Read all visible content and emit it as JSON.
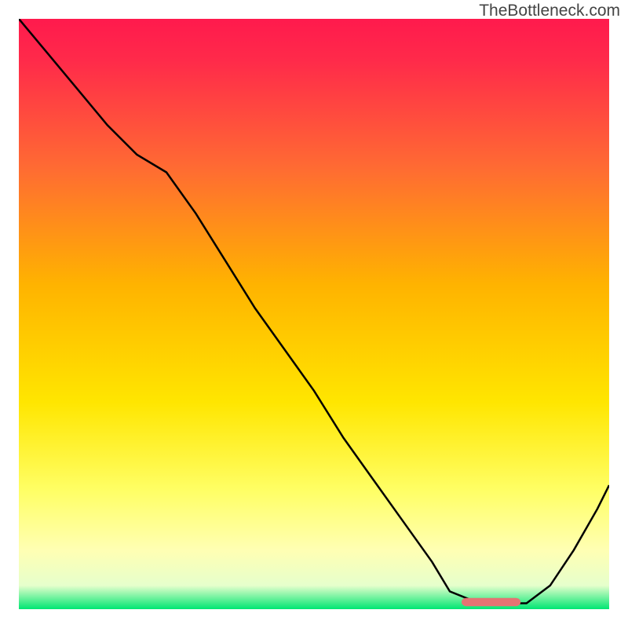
{
  "watermark": "TheBottleneck.com",
  "chart_data": {
    "type": "line",
    "title": "",
    "xlabel": "",
    "ylabel": "",
    "xlim": [
      0,
      100
    ],
    "ylim": [
      0,
      100
    ],
    "grid": false,
    "background_gradient": {
      "direction": "vertical",
      "stops": [
        {
          "pos": 0.0,
          "color": "#ff1a4d"
        },
        {
          "pos": 0.07,
          "color": "#ff2a4a"
        },
        {
          "pos": 0.25,
          "color": "#ff6a33"
        },
        {
          "pos": 0.45,
          "color": "#ffb300"
        },
        {
          "pos": 0.65,
          "color": "#ffe600"
        },
        {
          "pos": 0.8,
          "color": "#ffff66"
        },
        {
          "pos": 0.9,
          "color": "#ffffb3"
        },
        {
          "pos": 0.96,
          "color": "#e6ffcc"
        },
        {
          "pos": 1.0,
          "color": "#00e673"
        }
      ]
    },
    "series": [
      {
        "name": "bottleneck-curve",
        "color": "#000000",
        "x": [
          0,
          5,
          10,
          15,
          20,
          25,
          30,
          35,
          40,
          45,
          50,
          55,
          60,
          65,
          70,
          73,
          78,
          82,
          86,
          90,
          94,
          98,
          100
        ],
        "y": [
          100,
          94,
          88,
          82,
          77,
          74,
          67,
          59,
          51,
          44,
          37,
          29,
          22,
          15,
          8,
          3,
          1,
          1,
          1,
          4,
          10,
          17,
          21
        ]
      }
    ],
    "marker": {
      "name": "optimal-marker",
      "shape": "rounded-bar",
      "color": "#e57373",
      "x_start": 75,
      "x_end": 85,
      "y": 1.2,
      "height_pct": 1.4
    }
  }
}
